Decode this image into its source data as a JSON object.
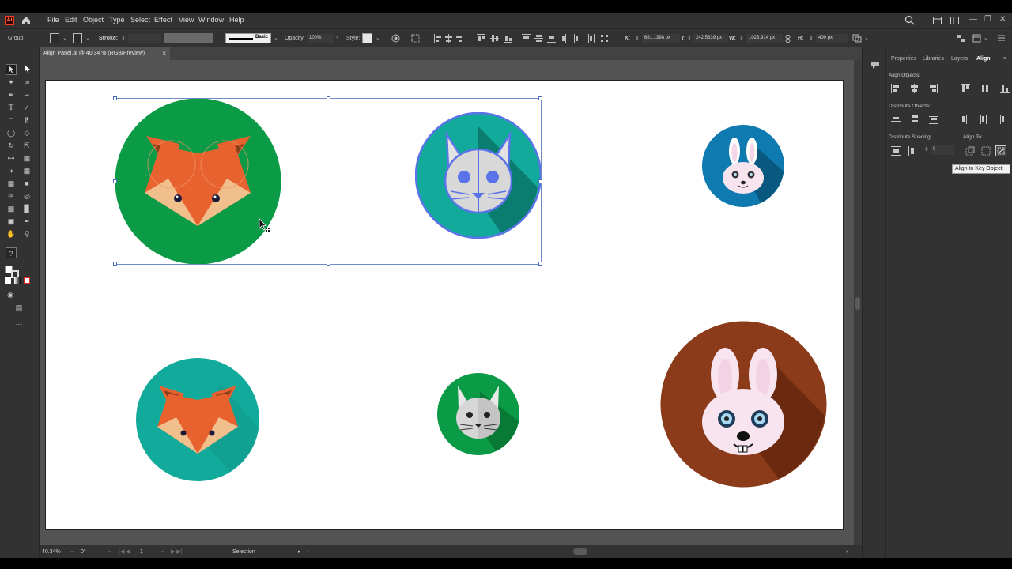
{
  "menu": {
    "items": [
      "File",
      "Edit",
      "Object",
      "Type",
      "Select",
      "Effect",
      "View",
      "Window",
      "Help"
    ]
  },
  "control": {
    "selection_type": "Group",
    "stroke_label": "Stroke:",
    "brush_label": "Basic",
    "opacity_label": "Opacity:",
    "opacity_value": "100%",
    "style_label": "Style:",
    "x_label": "X:",
    "x_value": "681.1398 px",
    "y_label": "Y:",
    "y_value": "242.5339 px",
    "w_label": "W:",
    "w_value": "1023.914 px",
    "h_label": "H:",
    "h_value": "400 px"
  },
  "document": {
    "tab_title": "Align Panel.ai @ 40.34 % (RGB/Preview)",
    "close": "×"
  },
  "status": {
    "zoom": "40.34%",
    "rotation": "0°",
    "artboard": "1",
    "tool": "Selection"
  },
  "panel": {
    "tabs": [
      "Properties",
      "Libraries",
      "Layers",
      "Align"
    ],
    "active_tab": "Align",
    "align_objects": "Align Objects:",
    "distribute_objects": "Distribute Objects:",
    "distribute_spacing": "Distribute Spacing:",
    "spacing_value": "0",
    "align_to": "Align To:",
    "tooltip": "Align to Key Object"
  },
  "toolbar": {
    "help": "?"
  },
  "colors": {
    "accent_selection": "#6d8ac7",
    "fox_orange": "#e8622f",
    "green": "#0b9a46",
    "teal": "#12aa9a",
    "blue": "#0e7ab0",
    "brown": "#8b3a1a"
  }
}
